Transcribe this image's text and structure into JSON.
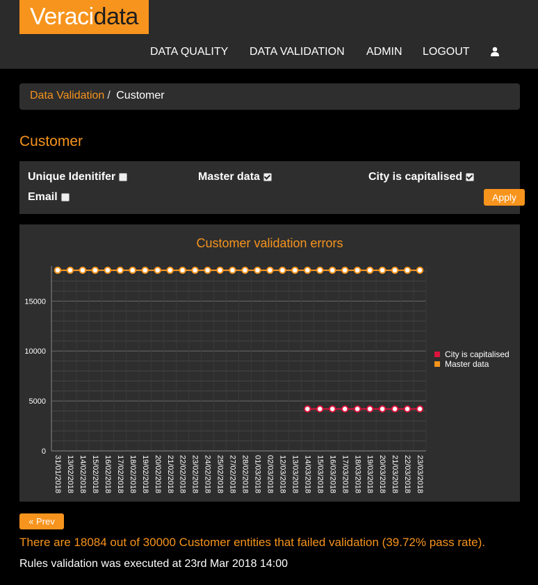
{
  "brand": {
    "part1": "Veraci",
    "part2": "data"
  },
  "nav": {
    "data_quality": "DATA QUALITY",
    "data_validation": "DATA VALIDATION",
    "admin": "ADMIN",
    "logout": "LOGOUT",
    "user_icon": "user-icon"
  },
  "breadcrumb": {
    "parent": "Data Validation",
    "separator": "/",
    "current": "Customer"
  },
  "page_title": "Customer",
  "rules": {
    "unique_identifier": {
      "label": "Unique Idenitifer",
      "checked": false
    },
    "master_data": {
      "label": "Master data",
      "checked": true
    },
    "city_capitalised": {
      "label": "City is capitalised",
      "checked": true
    },
    "email": {
      "label": "Email",
      "checked": false
    },
    "apply_label": "Apply"
  },
  "colors": {
    "accent": "#f7941d",
    "city_series": "#dc143c",
    "panel": "#2e2e2e"
  },
  "chart_data": {
    "type": "line",
    "title": "Customer validation errors",
    "xlabel": "",
    "ylabel": "",
    "ylim": [
      0,
      18500
    ],
    "yticks": [
      0,
      5000,
      10000,
      15000
    ],
    "grid": true,
    "legend_position": "right",
    "x": [
      "31/01/2018",
      "13/02/2018",
      "14/02/2018",
      "15/02/2018",
      "16/02/2018",
      "17/02/2018",
      "18/02/2018",
      "19/02/2018",
      "20/02/2018",
      "21/02/2018",
      "22/02/2018",
      "23/02/2018",
      "24/02/2018",
      "25/02/2018",
      "27/02/2018",
      "28/02/2018",
      "01/03/2018",
      "02/03/2018",
      "12/03/2018",
      "13/03/2018",
      "14/03/2018",
      "15/03/2018",
      "16/03/2018",
      "17/03/2018",
      "18/03/2018",
      "19/03/2018",
      "20/03/2018",
      "21/03/2018",
      "22/03/2018",
      "23/03/2018"
    ],
    "series": [
      {
        "name": "City is capitalised",
        "color": "#dc143c",
        "values": [
          null,
          null,
          null,
          null,
          null,
          null,
          null,
          null,
          null,
          null,
          null,
          null,
          null,
          null,
          null,
          null,
          null,
          null,
          null,
          null,
          4200,
          4200,
          4200,
          4200,
          4200,
          4200,
          4200,
          4200,
          4200,
          4200
        ]
      },
      {
        "name": "Master data",
        "color": "#f7941d",
        "values": [
          18084,
          18084,
          18084,
          18084,
          18084,
          18084,
          18084,
          18084,
          18084,
          18084,
          18084,
          18084,
          18084,
          18084,
          18084,
          18084,
          18084,
          18084,
          18084,
          18084,
          18084,
          18084,
          18084,
          18084,
          18084,
          18084,
          18084,
          18084,
          18084,
          18084
        ]
      }
    ]
  },
  "pagination": {
    "prev_label": "« Prev"
  },
  "summary": "There are 18084 out of 30000 Customer entities that failed validation (39.72% pass rate).",
  "execution": "Rules validation was executed at 23rd Mar 2018 14:00"
}
